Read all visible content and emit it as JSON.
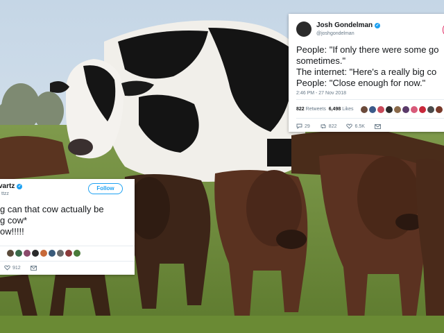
{
  "colors": {
    "sky": "#cfdde9",
    "grass": "#6f8f3a",
    "cow_black": "#151515",
    "cow_white": "#f2f0ec",
    "steer_brown": "#4a2a1a",
    "twitter_blue": "#1da1f2"
  },
  "tweet_right": {
    "name": "Josh Gondelman",
    "handle": "@joshgondelman",
    "verified_icon": "verified-badge-icon",
    "body": "People: \"If only there were some go\nsometimes.\"\nThe internet: \"Here's a really big co\nPeople: \"Close enough for now.\"",
    "timestamp": "2:46 PM - 27 Nov 2018",
    "retweets": "822",
    "retweets_label": "Retweets",
    "likes": "6,498",
    "likes_label": "Likes",
    "replies_count": "29",
    "retweet_count": "822",
    "like_count": "6.5K"
  },
  "tweet_left": {
    "handle_fragment": "vartz",
    "handle2_fragment": "ttzz",
    "verified_icon": "verified-badge-icon",
    "follow_label": "Follow",
    "body": "g can that cow actually be\ng cow*\now!!!!!",
    "like_count": "912"
  },
  "mini_avatar_colors_right": [
    "#6b4a3a",
    "#3b5a8a",
    "#c84a5a",
    "#2a2a2a",
    "#8a6a4a",
    "#5a3a6a",
    "#d85a7a",
    "#c8283a",
    "#4a4a4a",
    "#7a3a2a"
  ],
  "mini_avatar_colors_left": [
    "#5a4a3a",
    "#3a6a4a",
    "#8a4a6a",
    "#2a2a2a",
    "#c86a3a",
    "#3a5a7a",
    "#6a6a6a",
    "#8a3a3a",
    "#4a7a3a"
  ]
}
